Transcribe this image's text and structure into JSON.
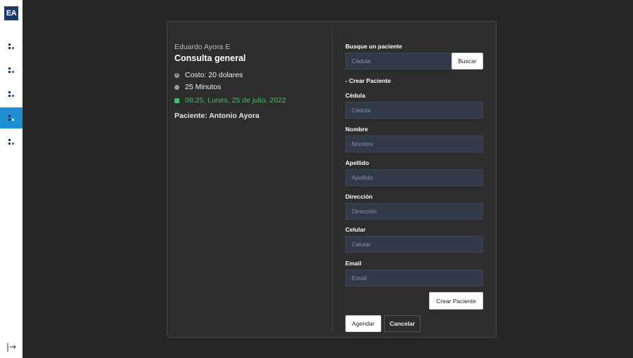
{
  "sidebar": {
    "logo": "EA",
    "items": [
      {
        "icon": "grid-dots-icon",
        "active": false
      },
      {
        "icon": "grid-dots-icon",
        "active": false
      },
      {
        "icon": "grid-dots-icon",
        "active": false
      },
      {
        "icon": "grid-dots-icon",
        "active": true
      },
      {
        "icon": "grid-dots-icon",
        "active": false
      }
    ],
    "logout_icon": "→"
  },
  "appointment": {
    "doctor": "Eduardo Ayora E",
    "type": "Consulta general",
    "cost": "Costo: 20 dolares",
    "duration": "25 Minutos",
    "datetime": "08:25, Lunes, 25 de julio, 2022",
    "patient": "Paciente: Antonio Ayora"
  },
  "search": {
    "label": "Busque un paciente",
    "placeholder": "Cédula",
    "button": "Buscar"
  },
  "create": {
    "toggle": "- Crear Paciente",
    "fields": {
      "cedula": {
        "label": "Cédula",
        "placeholder": "Cédula"
      },
      "nombre": {
        "label": "Nombre",
        "placeholder": "Nombre"
      },
      "apellido": {
        "label": "Apellido",
        "placeholder": "Apellido"
      },
      "direccion": {
        "label": "Dirección",
        "placeholder": "Dirección"
      },
      "celular": {
        "label": "Celular",
        "placeholder": "Celular"
      },
      "email": {
        "label": "Email",
        "placeholder": "Email"
      }
    },
    "button": "Crear Paciente"
  },
  "actions": {
    "schedule": "Agendar",
    "cancel": "Cancelar"
  },
  "colors": {
    "accent": "#1b8fd1",
    "date_green": "#3fbf6b",
    "background": "#262626",
    "card": "#2d2d2d"
  }
}
